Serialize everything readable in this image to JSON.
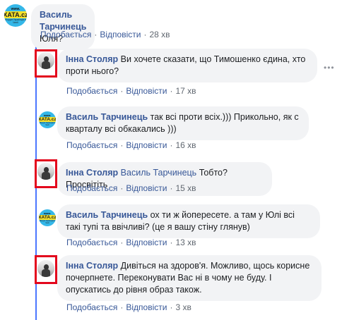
{
  "thread": {
    "top": {
      "author": "Василь Тарчинець",
      "text": "Юля?",
      "like": "Подобається",
      "reply": "Відповісти",
      "time": "28 хв"
    },
    "replies": [
      {
        "author": "Інна Столяр",
        "text": "Ви хочете сказати, що Тимошенко єдина, хто проти нього?",
        "like": "Подобається",
        "reply": "Відповісти",
        "time": "17 хв"
      },
      {
        "author": "Василь Тарчинець",
        "text": "так всі проти всіх.))) Прикольно, як с кварталу всі обкакались )))",
        "like": "Подобається",
        "reply": "Відповісти",
        "time": "16 хв"
      },
      {
        "author": "Інна Столяр",
        "mention": "Василь Тарчинець",
        "text": "Тобто? Просвітіть",
        "like": "Подобається",
        "reply": "Відповісти",
        "time": "15 хв"
      },
      {
        "author": "Василь Тарчинець",
        "text": "ох ти ж йопересете. а там у Юлі всі такі тупі та ввічливі? (це я вашу стіну глянув)",
        "like": "Подобається",
        "reply": "Відповісти",
        "time": "13 хв"
      },
      {
        "author": "Інна Столяр",
        "text": "Дивіться на здоров'я. Можливо, щось корисне почерпнете. Переконувати Вас ні в чому не буду. І опускатись до рівня образ також.",
        "like": "Подобається",
        "reply": "Відповісти",
        "time": "3 хв"
      }
    ]
  },
  "avatar_logo": {
    "line1": "www.",
    "line2": "XATA.cz",
    "line3": "Форум Українців в Чехії"
  },
  "colors": {
    "author": "#385898",
    "thread_line": "#4b76ff",
    "bubble": "#f2f3f5",
    "highlight": "#e3071d"
  }
}
